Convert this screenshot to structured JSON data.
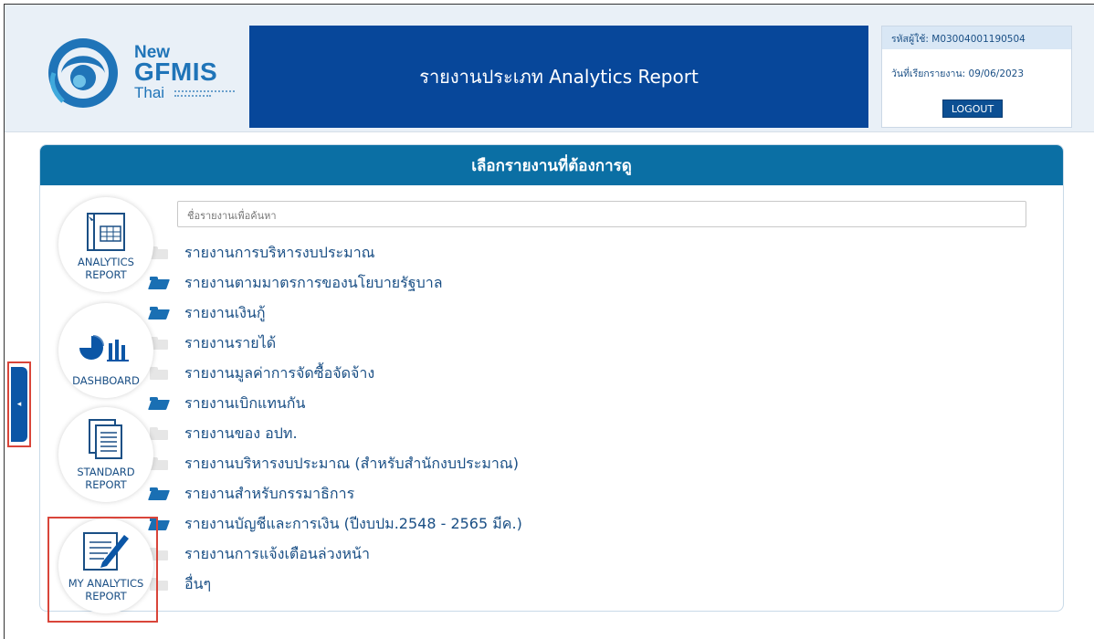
{
  "header": {
    "logo": {
      "new": "New",
      "gfmis": "GFMIS",
      "thai": "Thai"
    },
    "title": "รายงานประเภท Analytics Report",
    "user": {
      "id_label": "รหัสผู้ใช้:",
      "id_value": "M03004001190504",
      "date_label": "วันที่เรียกรายงาน:",
      "date_value": "09/06/2023",
      "logout": "LOGOUT"
    }
  },
  "panel": {
    "title": "เลือกรายงานที่ต้องการดู",
    "search_placeholder": "ชื่อรายงานเพื่อค้นหา",
    "reports": [
      {
        "label": "รายงานการบริหารงบประมาณ",
        "open": false
      },
      {
        "label": "รายงานตามมาตรการของนโยบายรัฐบาล",
        "open": true
      },
      {
        "label": "รายงานเงินกู้",
        "open": true
      },
      {
        "label": "รายงานรายได้",
        "open": false
      },
      {
        "label": "รายงานมูลค่าการจัดซื้อจัดจ้าง",
        "open": false
      },
      {
        "label": "รายงานเบิกแทนกัน",
        "open": true
      },
      {
        "label": "รายงานของ อปท.",
        "open": false
      },
      {
        "label": "รายงานบริหารงบประมาณ (สำหรับสำนักงบประมาณ)",
        "open": false
      },
      {
        "label": "รายงานสำหรับกรรมาธิการ",
        "open": true
      },
      {
        "label": "รายงานบัญชีและการเงิน (ปีงบปม.2548 - 2565 มีค.)",
        "open": true
      },
      {
        "label": "รายงานการแจ้งเตือนล่วงหน้า",
        "open": false
      },
      {
        "label": "อื่นๆ",
        "open": false
      }
    ]
  },
  "nav": {
    "analytics": [
      "ANALYTICS",
      "REPORT"
    ],
    "dashboard": [
      "DASHBOARD"
    ],
    "standard": [
      "STANDARD",
      "REPORT"
    ],
    "my_analytics": [
      "MY ANALYTICS",
      "REPORT"
    ]
  },
  "colors": {
    "primary": "#07479a",
    "panel_header": "#0b6fa4",
    "text": "#1a4f85",
    "highlight": "#d9453a"
  }
}
